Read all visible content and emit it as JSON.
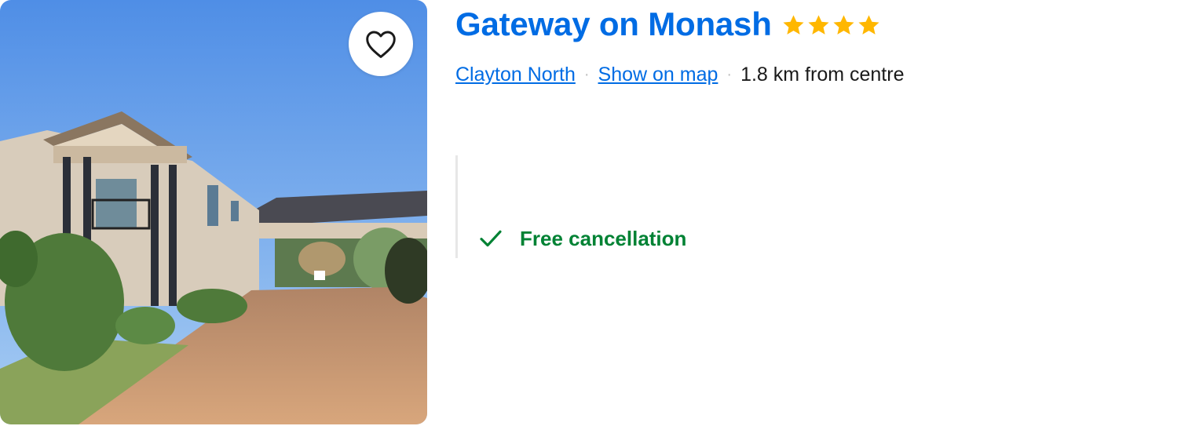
{
  "hotel": {
    "name": "Gateway on Monash",
    "star_rating": 4,
    "area_link": "Clayton North",
    "map_link": "Show on map",
    "distance": "1.8 km from centre",
    "separator": "·",
    "feature": "Free cancellation"
  },
  "icons": {
    "favorite": "heart-outline-icon",
    "check": "check-icon",
    "star": "star-icon"
  },
  "colors": {
    "link": "#006ce4",
    "star": "#ffb700",
    "success": "#008234",
    "divider": "#e7e7e7"
  }
}
